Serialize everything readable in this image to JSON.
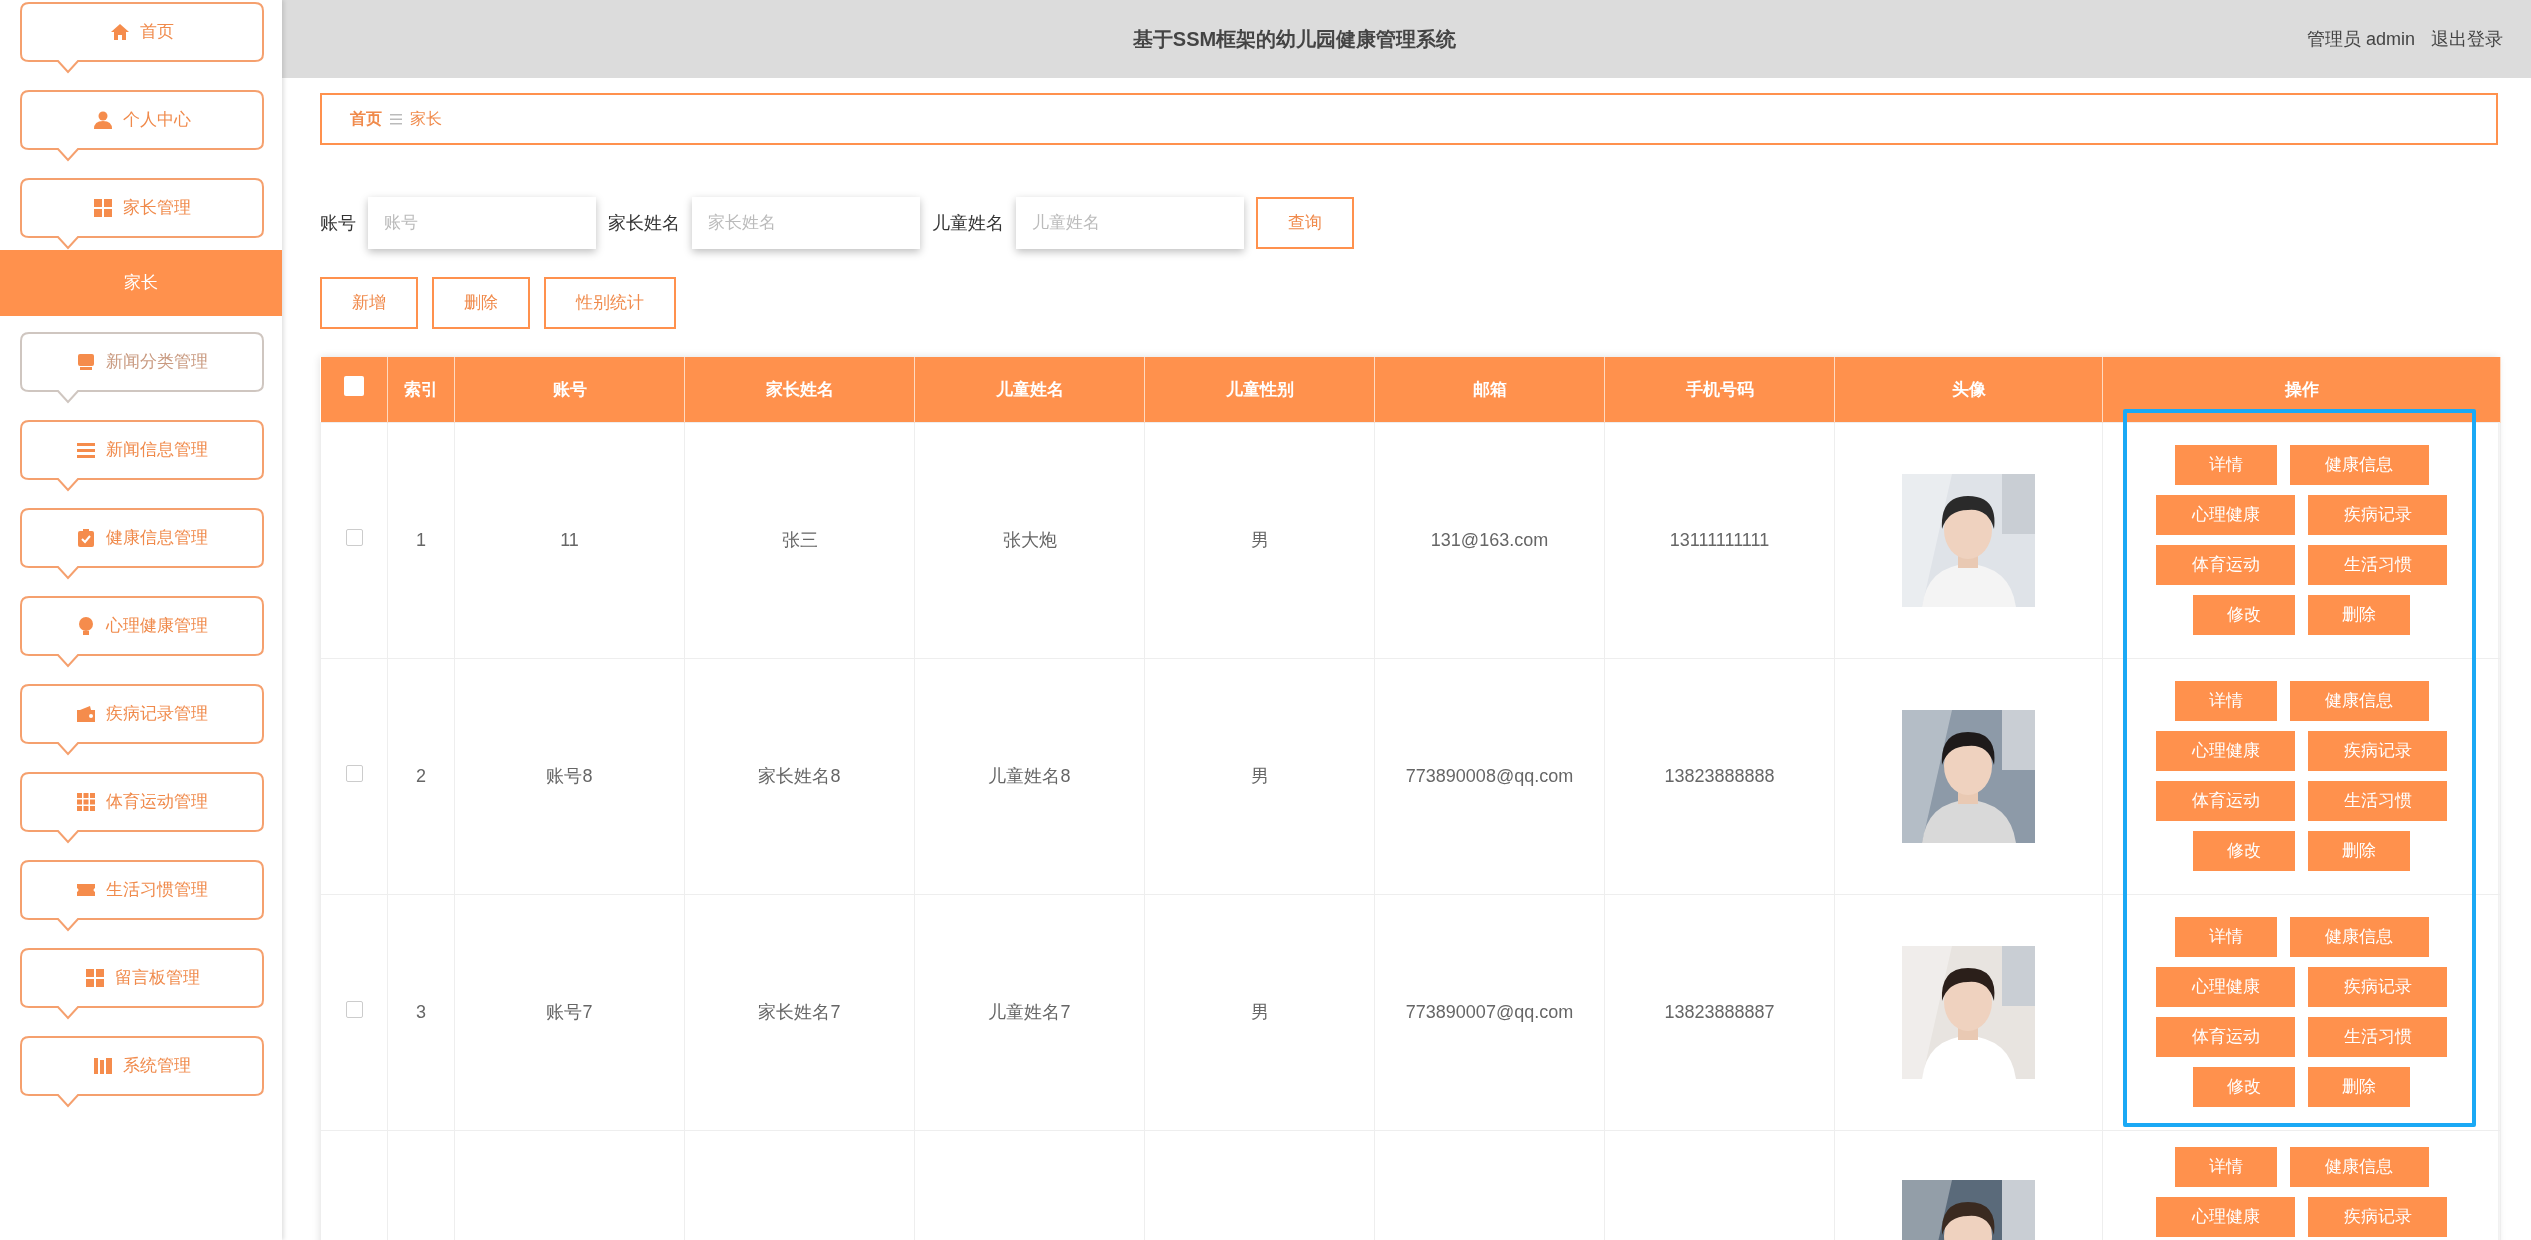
{
  "sidebar": {
    "items": [
      {
        "label": "首页",
        "hover": false
      },
      {
        "label": "个人中心",
        "hover": false
      },
      {
        "label": "家长管理",
        "hover": false,
        "children": [
          {
            "label": "家长",
            "selected": true
          }
        ]
      },
      {
        "label": "新闻分类管理",
        "hover": true
      },
      {
        "label": "新闻信息管理",
        "hover": false
      },
      {
        "label": "健康信息管理",
        "hover": false
      },
      {
        "label": "心理健康管理",
        "hover": false
      },
      {
        "label": "疾病记录管理",
        "hover": false
      },
      {
        "label": "体育运动管理",
        "hover": false
      },
      {
        "label": "生活习惯管理",
        "hover": false
      },
      {
        "label": "留言板管理",
        "hover": false
      },
      {
        "label": "系统管理",
        "hover": false
      }
    ]
  },
  "header": {
    "title": "基于SSM框架的幼儿园健康管理系统",
    "user": "管理员 admin",
    "logout": "退出登录"
  },
  "breadcrumb": [
    "首页",
    "家长"
  ],
  "search": {
    "fields": [
      {
        "label": "账号",
        "placeholder": "账号"
      },
      {
        "label": "家长姓名",
        "placeholder": "家长姓名"
      },
      {
        "label": "儿童姓名",
        "placeholder": "儿童姓名"
      }
    ],
    "button": "查询"
  },
  "toolbar": [
    "新增",
    "删除",
    "性别统计"
  ],
  "table": {
    "select_all": {
      "checked": false
    },
    "columns": [
      "索引",
      "账号",
      "家长姓名",
      "儿童姓名",
      "儿童性别",
      "邮箱",
      "手机号码",
      "头像",
      "操作"
    ],
    "rows": [
      {
        "checked": false,
        "highlighted": true,
        "cells": [
          "1",
          "11",
          "张三",
          "张大炮",
          "男",
          "131@163.com",
          "13111111111"
        ],
        "avatar": {
          "kind": "picture"
        },
        "actions": [
          "详情",
          "健康信息",
          "心理健康",
          "疾病记录",
          "体育运动",
          "生活习惯",
          "修改",
          "删除"
        ]
      },
      {
        "checked": false,
        "highlighted": true,
        "cells": [
          "2",
          "账号8",
          "家长姓名8",
          "儿童姓名8",
          "男",
          "773890008@qq.com",
          "13823888888"
        ],
        "avatar": {
          "kind": "picture"
        },
        "actions": [
          "详情",
          "健康信息",
          "心理健康",
          "疾病记录",
          "体育运动",
          "生活习惯",
          "修改",
          "删除"
        ]
      },
      {
        "checked": false,
        "highlighted": true,
        "cells": [
          "3",
          "账号7",
          "家长姓名7",
          "儿童姓名7",
          "男",
          "773890007@qq.com",
          "13823888887"
        ],
        "avatar": {
          "kind": "picture"
        },
        "actions": [
          "详情",
          "健康信息",
          "心理健康",
          "疾病记录",
          "体育运动",
          "生活习惯",
          "修改",
          "删除"
        ]
      },
      {
        "avatar": {
          "kind": "picture"
        },
        "actions": [
          "详情",
          "健康信息",
          "心理健康",
          "疾病记录"
        ]
      }
    ]
  }
}
